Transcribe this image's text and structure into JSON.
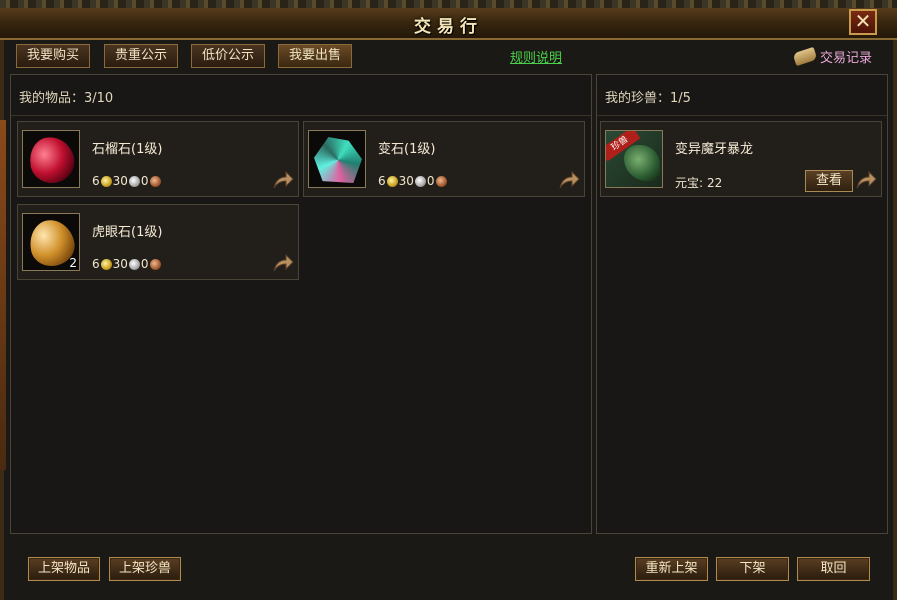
{
  "window": {
    "title": "交易行",
    "close_label": "✕"
  },
  "tabs": [
    {
      "label": "我要购买"
    },
    {
      "label": "贵重公示"
    },
    {
      "label": "低价公示"
    },
    {
      "label": "我要出售"
    }
  ],
  "links": {
    "rules": "规则说明",
    "records": "交易记录"
  },
  "items_panel": {
    "header": "我的物品：3/10",
    "items": [
      {
        "name": "石榴石(1级)",
        "icon": "ruby-gem-icon",
        "gold": "6",
        "silver": "30",
        "copper": "0",
        "count": ""
      },
      {
        "name": "变石(1级)",
        "icon": "crystal-gem-icon",
        "gold": "6",
        "silver": "30",
        "copper": "0",
        "count": ""
      },
      {
        "name": "虎眼石(1级)",
        "icon": "tiger-eye-gem-icon",
        "gold": "6",
        "silver": "30",
        "copper": "0",
        "count": "2"
      }
    ]
  },
  "pets_panel": {
    "header": "我的珍兽：1/5",
    "pets": [
      {
        "name": "变异魔牙暴龙",
        "price_label": "元宝:",
        "price_value": "22",
        "view_label": "查看",
        "tag": "珍兽"
      }
    ]
  },
  "footer": {
    "list_item": "上架物品",
    "list_pet": "上架珍兽",
    "relist": "重新上架",
    "delist": "下架",
    "cancel": "取回"
  },
  "colors": {
    "link_green": "#4ad04a",
    "record_pink": "#e8a8d8",
    "gold_text": "#f4e6c4"
  }
}
